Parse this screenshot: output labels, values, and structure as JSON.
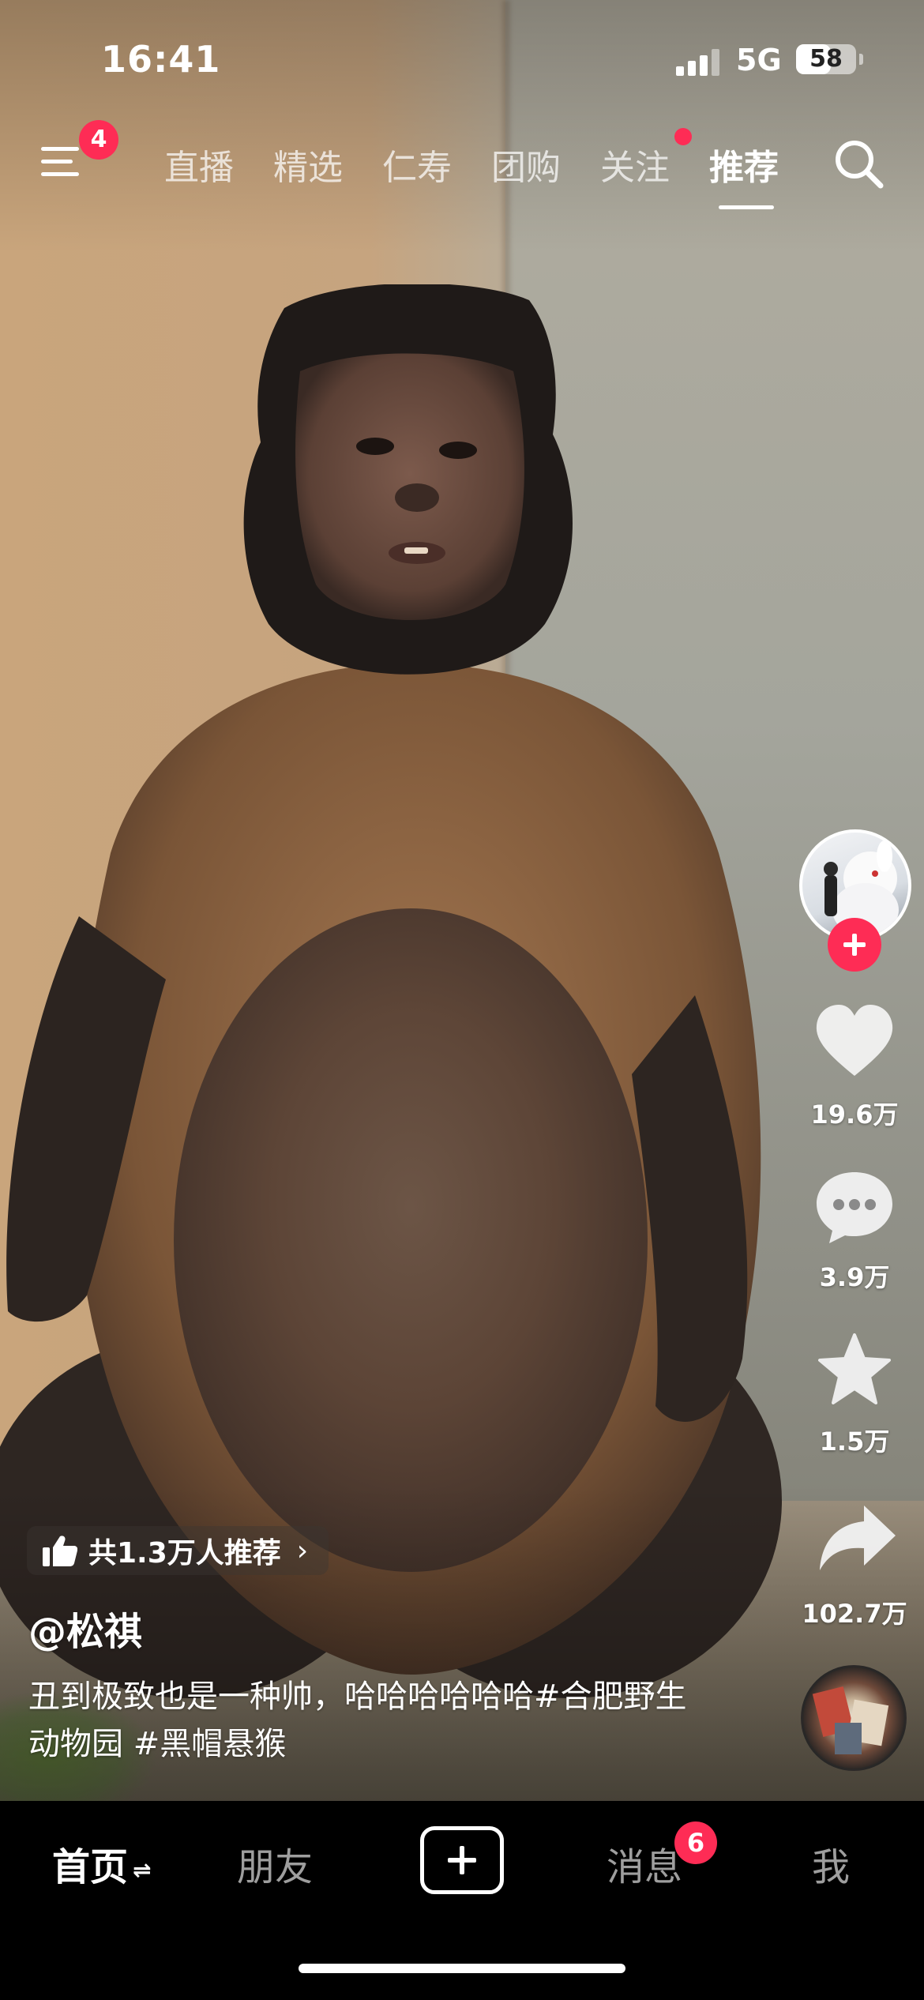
{
  "status_bar": {
    "time": "16:41",
    "network": "5G",
    "battery": "58",
    "battery_level": 0.58
  },
  "top_nav": {
    "menu_badge": "4",
    "tabs": [
      {
        "label": "直播"
      },
      {
        "label": "精选"
      },
      {
        "label": "仁寿"
      },
      {
        "label": "团购"
      },
      {
        "label": "关注"
      },
      {
        "label": "推荐"
      }
    ],
    "active_tab": "推荐"
  },
  "rail": {
    "likes": "19.6万",
    "comments": "3.9万",
    "favorites": "1.5万",
    "shares": "102.7万"
  },
  "video": {
    "recommend": "共1.3万人推荐",
    "author": "@松祺",
    "description": "丑到极致也是一种帅，哈哈哈哈哈哈#合肥野生动物园 #黑帽悬猴"
  },
  "bottom_nav": {
    "home": "首页",
    "friends": "朋友",
    "messages": "消息",
    "messages_badge": "6",
    "me": "我"
  },
  "colors": {
    "accent": "#fe2c55",
    "background": "#000000"
  }
}
